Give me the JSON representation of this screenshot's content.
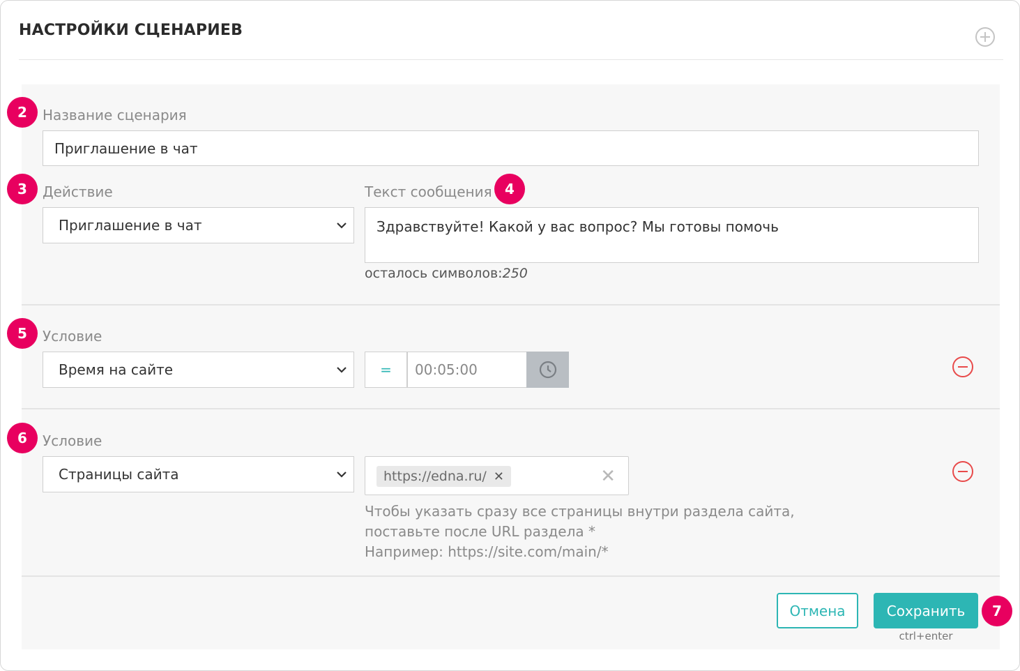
{
  "header": {
    "title": "НАСТРОЙКИ СЦЕНАРИЕВ",
    "add_icon": "plus-circle-icon"
  },
  "badges": [
    "2",
    "3",
    "4",
    "5",
    "6",
    "7"
  ],
  "scenario": {
    "name_label": "Название сценария",
    "name_value": "Приглашение в чат",
    "action_label": "Действие",
    "action_value": "Приглашение в чат",
    "message_label": "Текст сообщения",
    "message_value": "Здравствуйте! Какой у вас вопрос? Мы готовы помочь",
    "counter_label": "осталось символов:",
    "counter_value": "250"
  },
  "condition1": {
    "label": "Условие",
    "type_value": "Время на сайте",
    "operator": "=",
    "time_value": "00:05:00"
  },
  "condition2": {
    "label": "Условие",
    "type_value": "Страницы сайта",
    "tags": [
      "https://edna.ru/"
    ],
    "hint_line1": "Чтобы указать сразу все страницы внутри раздела сайта,",
    "hint_line2": "поставьте после URL раздела *",
    "hint_line3": "Например: https://site.com/main/*"
  },
  "footer": {
    "cancel_label": "Отмена",
    "save_label": "Сохранить",
    "shortcut": "ctrl+enter"
  },
  "colors": {
    "accent": "#2db6b4",
    "badge": "#e8005f",
    "danger": "#e84a4a"
  }
}
